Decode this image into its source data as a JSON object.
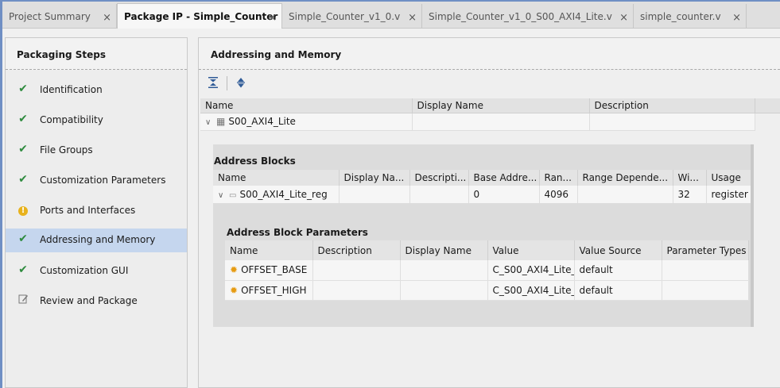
{
  "tabs": [
    {
      "label": "Project Summary",
      "close": "×"
    },
    {
      "label": "Package IP - Simple_Counter",
      "close": "×"
    },
    {
      "label": "Simple_Counter_v1_0.v",
      "close": "×"
    },
    {
      "label": "Simple_Counter_v1_0_S00_AXI4_Lite.v",
      "close": "×"
    },
    {
      "label": "simple_counter.v",
      "close": "×"
    }
  ],
  "left": {
    "title": "Packaging Steps",
    "steps": [
      {
        "label": "Identification",
        "status": "check"
      },
      {
        "label": "Compatibility",
        "status": "check"
      },
      {
        "label": "File Groups",
        "status": "check"
      },
      {
        "label": "Customization Parameters",
        "status": "check"
      },
      {
        "label": "Ports and Interfaces",
        "status": "warning"
      },
      {
        "label": "Addressing and Memory",
        "status": "check"
      },
      {
        "label": "Customization GUI",
        "status": "check"
      },
      {
        "label": "Review and Package",
        "status": "edit"
      }
    ]
  },
  "right": {
    "title": "Addressing and Memory",
    "memory_map": {
      "columns": [
        "Name",
        "Display Name",
        "Description"
      ],
      "row": {
        "name": "S00_AXI4_Lite",
        "display_name": "",
        "description": ""
      }
    },
    "address_blocks": {
      "title": "Address Blocks",
      "columns": [
        "Name",
        "Display Na...",
        "Descripti...",
        "Base Addre...",
        "Ran...",
        "Range Depende...",
        "Wi...",
        "Usage"
      ],
      "row": {
        "name": "S00_AXI4_Lite_reg",
        "display_name": "",
        "description": "",
        "base_address": "0",
        "range": "4096",
        "range_dependency": "",
        "width": "32",
        "usage": "register"
      }
    },
    "block_params": {
      "title": "Address Block Parameters",
      "columns": [
        "Name",
        "Description",
        "Display Name",
        "Value",
        "Value Source",
        "Parameter Types"
      ],
      "rows": [
        {
          "name": "OFFSET_BASE",
          "description": "",
          "display_name": "",
          "value": "C_S00_AXI4_Lite_",
          "source": "default",
          "types": ""
        },
        {
          "name": "OFFSET_HIGH",
          "description": "",
          "display_name": "",
          "value": "C_S00_AXI4_Lite_",
          "source": "default",
          "types": ""
        }
      ]
    }
  }
}
